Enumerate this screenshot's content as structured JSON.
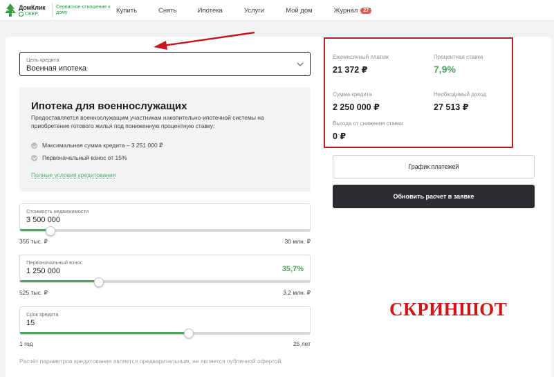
{
  "header": {
    "logo_name": "ДомКлик",
    "logo_sub": "СБЕР",
    "slogan": "Сервисное отношение к дому",
    "nav": [
      "Купить",
      "Снять",
      "Ипотека",
      "Услуги",
      "Мой дом",
      "Журнал"
    ],
    "journal_badge": "27"
  },
  "purpose": {
    "label": "Цель кредита",
    "value": "Военная ипотека"
  },
  "info": {
    "title": "Ипотека для военнослужащих",
    "description": "Предоставляется военнослужащим участникам накопительно-ипотечной системы на приобретение готового жилья под пониженную процентную ставку:",
    "bullets": [
      "Максимальная сумма кредита – 3 251 000 ₽",
      "Первоначальный взнос от 15%"
    ],
    "link": "Полные условия кредитования"
  },
  "property_cost": {
    "label": "Стоимость недвижимости",
    "value": "3 500 000",
    "min": "355 тыс. ₽",
    "max": "30 млн. ₽",
    "fraction": 0.106
  },
  "down_payment": {
    "label": "Первоначальный взнос",
    "value": "1 250 000",
    "percent": "35,7%",
    "min": "525 тыс. ₽",
    "max": "3.2 млн. ₽",
    "fraction": 0.272
  },
  "term": {
    "label": "Срок кредита",
    "value": "15",
    "min": "1 год",
    "max": "25 лет",
    "fraction": 0.583
  },
  "disclaimer": "Расчёт параметров кредитования является предварительным, не является публичной офертой.",
  "results": {
    "monthly_label": "Ежемесячный платеж",
    "monthly_value": "21 372 ₽",
    "rate_label": "Процентная ставка",
    "rate_value": "7,9%",
    "loan_label": "Сумма кредита",
    "loan_value": "2 250 000 ₽",
    "income_label": "Необходимый доход",
    "income_value": "27 513 ₽",
    "benefit_label": "Выгода от снижения ставки",
    "benefit_value": "0 ₽"
  },
  "buttons": {
    "schedule": "График платежей",
    "update": "Обновить расчет в заявке"
  },
  "stamp": "СКРИНШОТ",
  "colors": {
    "accent_green": "#4fa35f",
    "annotation_red": "#c4161c",
    "dark_button": "#2b2d31"
  }
}
